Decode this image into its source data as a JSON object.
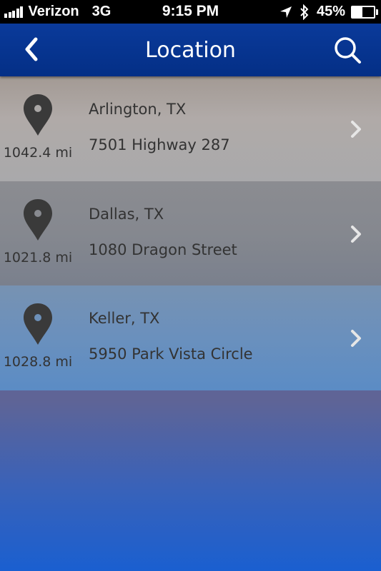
{
  "status_bar": {
    "carrier": "Verizon",
    "network": "3G",
    "time": "9:15 PM",
    "battery_percent_label": "45%",
    "battery_level": 0.45,
    "icons": [
      "signal-bars-icon",
      "location-arrow-icon",
      "bluetooth-icon",
      "battery-icon"
    ]
  },
  "nav": {
    "title": "Location",
    "back_icon": "chevron-left-icon",
    "search_icon": "search-icon"
  },
  "locations": [
    {
      "distance": "1042.4 mi",
      "city": "Arlington, TX",
      "address": "7501 Highway 287"
    },
    {
      "distance": "1021.8 mi",
      "city": "Dallas, TX",
      "address": "1080 Dragon Street"
    },
    {
      "distance": "1028.8 mi",
      "city": "Keller, TX",
      "address": "5950 Park Vista Circle"
    }
  ],
  "colors": {
    "nav_background": "#042f86",
    "text": "#333333",
    "pin": "#3a3a3a",
    "chevron": "#e6e6e6"
  }
}
